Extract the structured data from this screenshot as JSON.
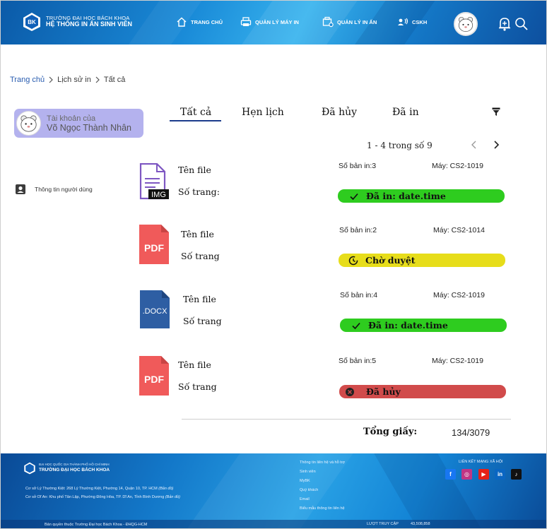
{
  "header": {
    "brand_small": "TRƯỜNG ĐẠI HỌC BÁCH KHOA",
    "brand_big": "HỆ THỐNG IN ẤN SINH VIÊN",
    "logo_text": "BK",
    "nav": [
      {
        "label": "TRANG CHỦ",
        "icon": "home-icon"
      },
      {
        "label": "QUẢN LÝ MÁY IN",
        "icon": "printer-icon"
      },
      {
        "label": "QUẢN LÝ IN ẤN",
        "icon": "print-settings-icon"
      },
      {
        "label": "CSKH",
        "icon": "support-icon"
      }
    ]
  },
  "breadcrumb": [
    "Trang chủ",
    "Lịch sử in",
    "Tất cả"
  ],
  "account": {
    "line1": "Tài khoản của",
    "line2": "Võ Ngọc Thành Nhân"
  },
  "sidebar": {
    "user_info": "Thông tin người dùng"
  },
  "tabs": [
    "Tất cả",
    "Hẹn lịch",
    "Đã hủy",
    "Đã in"
  ],
  "active_tab": "Tất cả",
  "pager": {
    "text": "1 - 4 trong số 9"
  },
  "rows": [
    {
      "icon": "image-file-icon",
      "badge": "IMG",
      "name": "Tên file",
      "pages": "Số trang:",
      "copies": "Số bản in:3",
      "machine": "Máy: CS2-1019",
      "status": "Đã in: date.time",
      "status_color": "#2ecc1f"
    },
    {
      "icon": "pdf-file-icon",
      "badge": "PDF",
      "name": "Tên file",
      "pages": "Số trang",
      "copies": "Số bản in:2",
      "machine": "Máy: CS2-1014",
      "status": "Chờ duyệt",
      "status_color": "#e7dd1a"
    },
    {
      "icon": "docx-file-icon",
      "badge": ".DOCX",
      "name": "Tên file",
      "pages": "Số trang",
      "copies": "Số bản in:4",
      "machine": "Máy: CS2-1019",
      "status": "Đã in: date.time",
      "status_color": "#2ecc1f"
    },
    {
      "icon": "pdf-file-icon",
      "badge": "PDF",
      "name": "Tên file",
      "pages": "Số trang",
      "copies": "Số bản in:5",
      "machine": "Máy: CS2-1019",
      "status": "Đã hủy",
      "status_color": "#d14b4b"
    }
  ],
  "total": {
    "label": "Tổng giấy:",
    "value": "134/3079"
  },
  "footer": {
    "uni_small": "ĐẠI HỌC QUỐC GIA THÀNH PHỐ HỒ CHÍ MINH",
    "uni_big": "TRƯỜNG ĐẠI HỌC BÁCH KHOA",
    "addr1": "Cơ sở Lý Thường Kiệt: 268 Lý Thường Kiệt, Phường 14, Quận 10, TP. HCM",
    "addr1_map": "(Bản đồ)",
    "addr2": "Cơ sở Dĩ An: Khu phố Tân Lập, Phường Đông Hòa, TP. Dĩ An, Tỉnh Bình Dương",
    "addr2_map": "(Bản đồ)",
    "links": [
      "Thông tin liên hệ và hỗ trợ",
      "Sinh viên",
      "MyBK",
      "Quý khách",
      "Email",
      "Biểu mẫu thông tin liên hệ"
    ],
    "social_title": "LIÊN KẾT MẠNG XÃ HỘI",
    "social": [
      {
        "label": "f",
        "icon": "facebook-icon",
        "color": "#1877f2"
      },
      {
        "label": "◎",
        "icon": "instagram-icon",
        "color": "#c13584"
      },
      {
        "label": "▶",
        "icon": "youtube-icon",
        "color": "#e62117"
      },
      {
        "label": "in",
        "icon": "linkedin-icon",
        "color": "#0a66c2"
      },
      {
        "label": "♪",
        "icon": "tiktok-icon",
        "color": "#111111"
      }
    ],
    "copyright": "Bản quyền thuộc Trường Đại học Bách Khoa - ĐHQG-HCM",
    "visits_label": "LƯỢT TRUY CẬP",
    "visits": "43,508,858"
  }
}
